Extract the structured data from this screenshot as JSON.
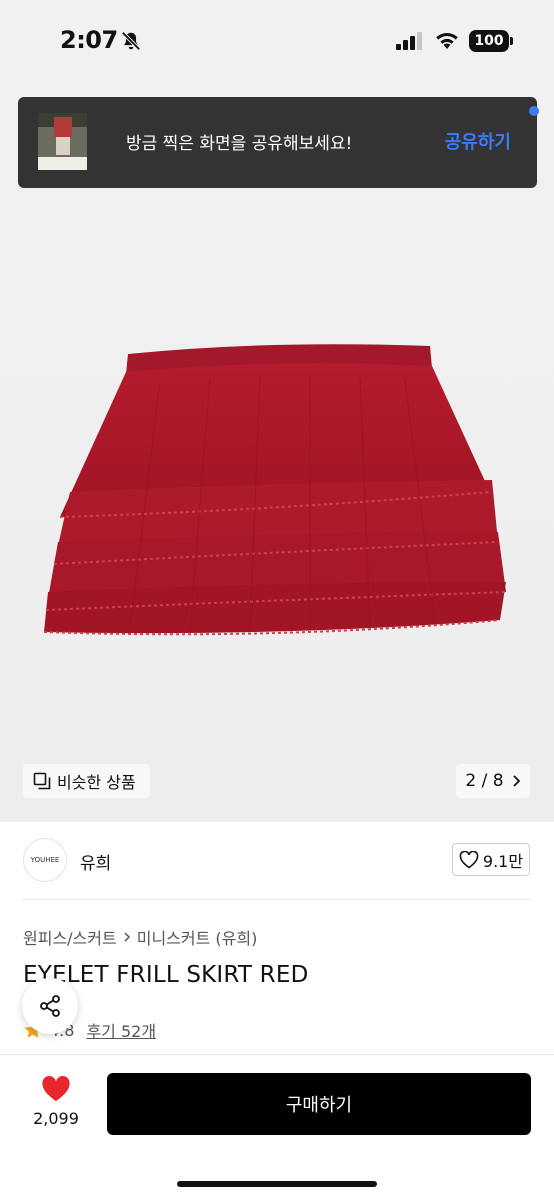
{
  "status_bar": {
    "time": "2:07",
    "battery": "100"
  },
  "toast": {
    "message": "방금 찍은 화면을 공유해보세요!",
    "action": "공유하기"
  },
  "image_overlay": {
    "similar_label": "비슷한 상품",
    "page_indicator": "2 / 8"
  },
  "brand": {
    "logo_text": "YOUHEE",
    "name": "유희",
    "likes": "9.1만"
  },
  "breadcrumb": {
    "category": "원피스/스커트",
    "subcategory": "미니스커트 (유희)"
  },
  "product": {
    "title": "EYELET FRILL SKIRT RED",
    "rating": "4.8",
    "reviews": "후기 52개"
  },
  "bottom_bar": {
    "like_count": "2,099",
    "buy_label": "구매하기"
  },
  "colors": {
    "accent": "#3b7bf6",
    "heart": "#e8262e",
    "skirt": "#b0182a"
  }
}
